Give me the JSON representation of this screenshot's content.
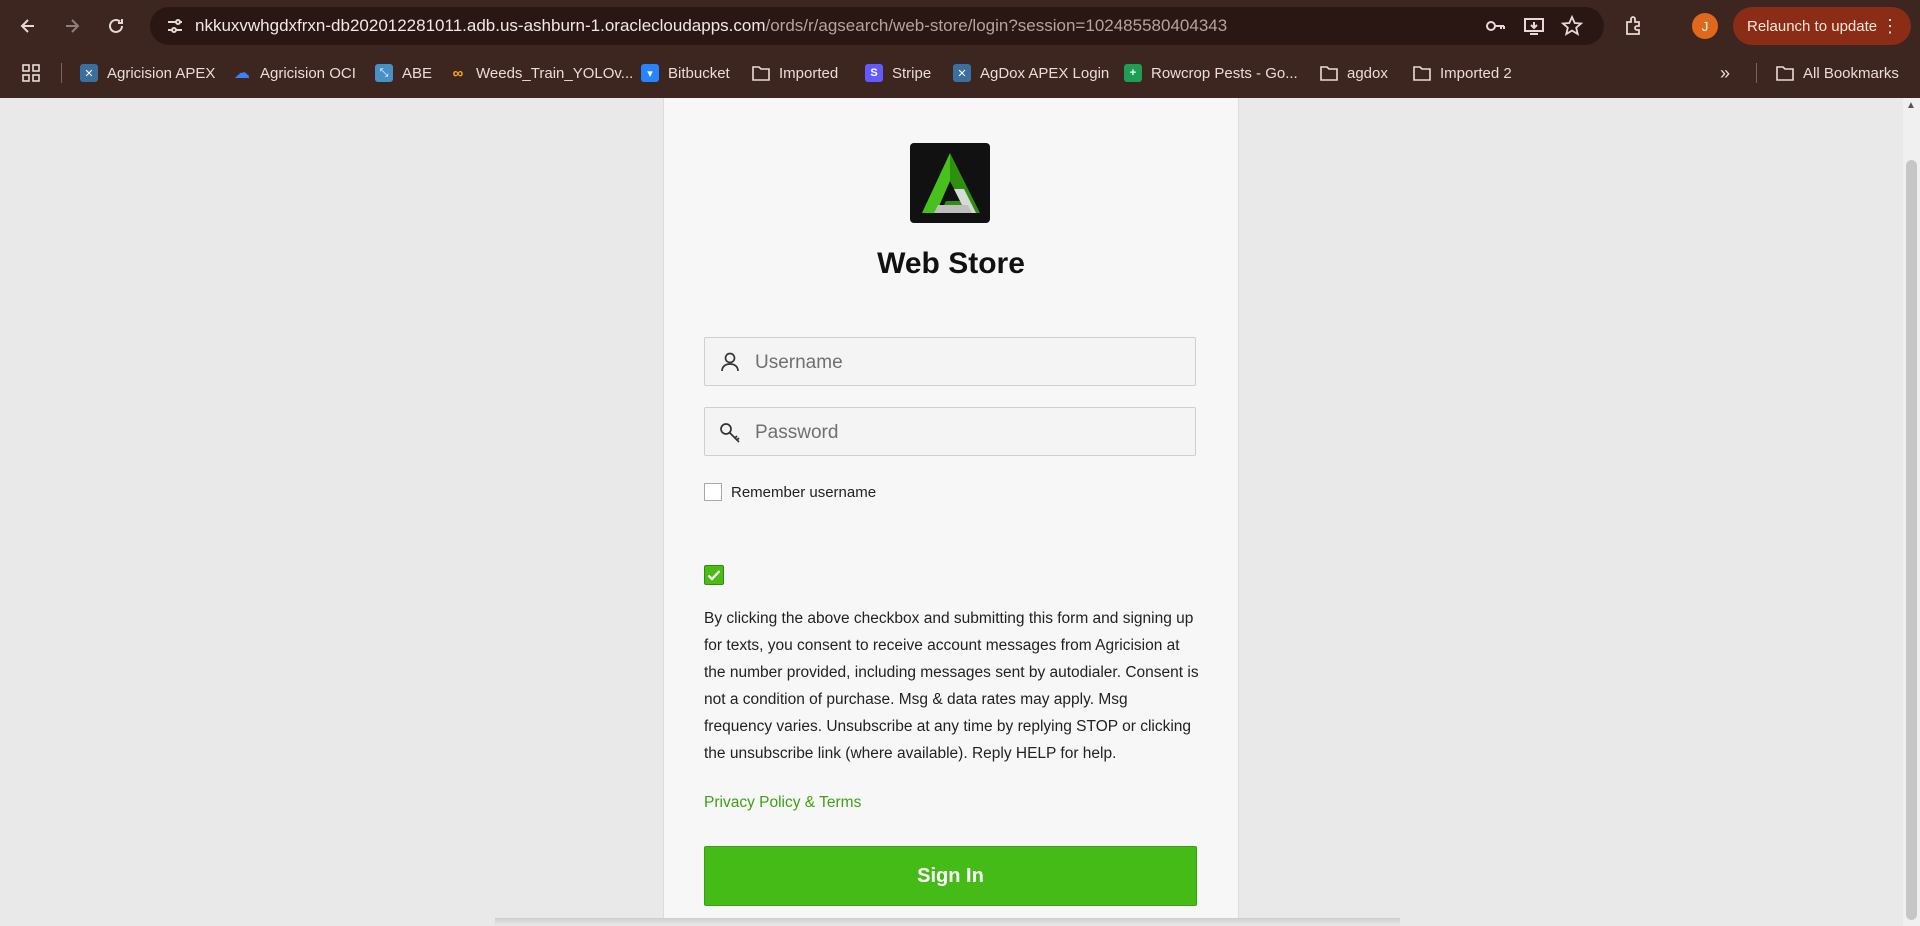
{
  "browser": {
    "url_main": "nkkuxvwhgdxfrxn-db202012281011.adb.us-ashburn-1.oraclecloudapps.com",
    "url_rest": "/ords/r/agsearch/web-store/login?session=102485580404343",
    "profile_initial": "J",
    "relaunch_label": "Relaunch to update",
    "bookmarks": [
      {
        "label": "Agricision APEX",
        "icon": "apex-icon"
      },
      {
        "label": "Agricision OCI",
        "icon": "cloud-icon"
      },
      {
        "label": "ABE",
        "icon": "abe-icon"
      },
      {
        "label": "Weeds_Train_YOLOv...",
        "icon": "colab-icon"
      },
      {
        "label": "Bitbucket",
        "icon": "bitbucket-icon"
      },
      {
        "label": "Imported",
        "icon": "folder-icon"
      },
      {
        "label": "Stripe",
        "icon": "stripe-icon"
      },
      {
        "label": "AgDox APEX Login",
        "icon": "apex-icon"
      },
      {
        "label": "Rowcrop Pests - Go...",
        "icon": "sheets-icon"
      },
      {
        "label": "agdox",
        "icon": "folder-icon"
      },
      {
        "label": "Imported 2",
        "icon": "folder-icon"
      }
    ],
    "more_bookmarks": "»",
    "all_bookmarks_label": "All Bookmarks"
  },
  "login": {
    "title": "Web Store",
    "username_placeholder": "Username",
    "password_placeholder": "Password",
    "remember_label": "Remember username",
    "remember_checked": false,
    "consent_checked": true,
    "consent_text": "By clicking the above checkbox and submitting this form and signing up for texts, you consent to receive account messages from Agricision at the number provided, including messages sent by autodialer. Consent is not a condition of purchase. Msg & data rates may apply. Msg frequency varies. Unsubscribe at any time by replying STOP or clicking the unsubscribe link (where available). Reply HELP for help.",
    "privacy_link": "Privacy Policy & Terms",
    "signin_label": "Sign In"
  },
  "colors": {
    "chrome_bg": "#3d2520",
    "accent_green": "#44bb17",
    "link_green": "#3f9f14",
    "relaunch_bg": "#8a2c16"
  }
}
